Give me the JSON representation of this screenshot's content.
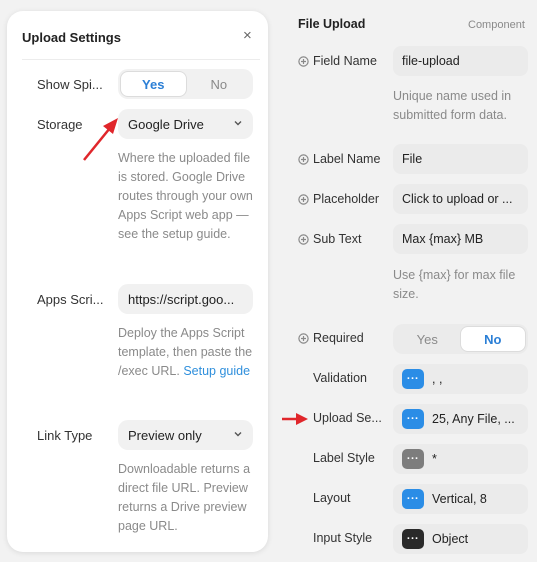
{
  "popover": {
    "title": "Upload Settings",
    "close_icon": "×",
    "show_spinner": {
      "label": "Show Spi...",
      "options": [
        "Yes",
        "No"
      ],
      "selected": "Yes"
    },
    "storage": {
      "label": "Storage",
      "value": "Google Drive",
      "help": "Where the uploaded file is stored. Google Drive routes through your own Apps Script web app — see the setup guide."
    },
    "apps_script": {
      "label": "Apps Scri...",
      "value": "https://script.goo...",
      "help_prefix": "Deploy the Apps Script template, then paste the /exec URL. ",
      "help_link": "Setup guide"
    },
    "link_type": {
      "label": "Link Type",
      "value": "Preview only",
      "help": "Downloadable returns a direct file URL. Preview returns a Drive preview page URL."
    }
  },
  "panel": {
    "title": "File Upload",
    "tag": "Component",
    "field_name": {
      "label": "Field Name",
      "value": "file-upload",
      "help": "Unique name used in submitted form data."
    },
    "label_name": {
      "label": "Label Name",
      "value": "File"
    },
    "placeholder": {
      "label": "Placeholder",
      "value": "Click to upload or ..."
    },
    "sub_text": {
      "label": "Sub Text",
      "value": "Max {max} MB",
      "help": "Use {max} for max file size."
    },
    "required": {
      "label": "Required",
      "options": [
        "Yes",
        "No"
      ],
      "selected": "No"
    },
    "validation": {
      "label": "Validation",
      "value": ", ,",
      "badge_color": "#2b8de6"
    },
    "upload_settings": {
      "label": "Upload Se...",
      "value": "25, Any File, ...",
      "badge_color": "#2b8de6"
    },
    "label_style": {
      "label": "Label Style",
      "value": "*",
      "badge_color": "#7d7d7d"
    },
    "layout": {
      "label": "Layout",
      "value": "Vertical, 8",
      "badge_color": "#2b8de6"
    },
    "input_style": {
      "label": "Input Style",
      "value": "Object",
      "badge_color": "#2a2a2a"
    }
  },
  "colors": {
    "accent": "#2b7fd6",
    "arrow": "#e0262b"
  }
}
